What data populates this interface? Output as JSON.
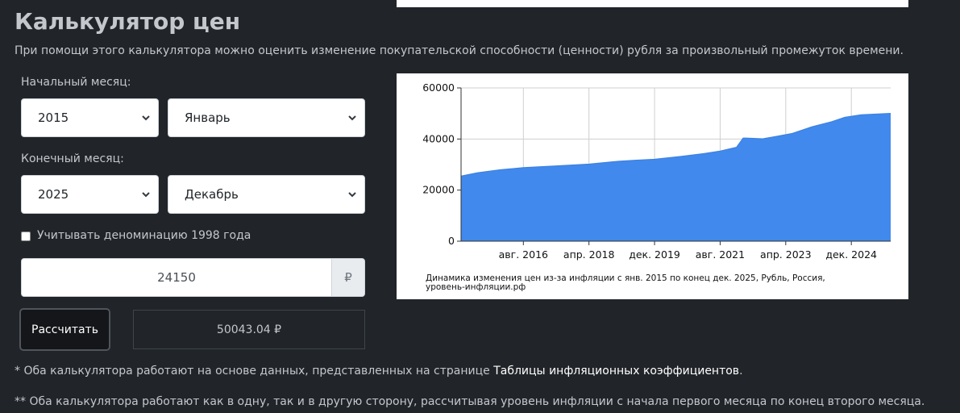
{
  "title": "Калькулятор цен",
  "description": "При помощи этого калькулятора можно оценить изменение покупательской способности (ценности) рубля за произвольный промежуток времени.",
  "form": {
    "start_label": "Начальный месяц:",
    "start_year": "2015",
    "start_month": "Январь",
    "end_label": "Конечный месяц:",
    "end_year": "2025",
    "end_month": "Декабрь",
    "denomination_label": "Учитывать деноминацию 1998 года",
    "denomination_checked": false,
    "amount": "24150",
    "currency": "₽",
    "calculate_label": "Рассчитать",
    "result": "50043.04 ₽"
  },
  "notes": {
    "note1_prefix": "* Оба калькулятора работают на основе данных, представленных на странице ",
    "note1_link": "Таблицы инфляционных коэффициентов",
    "note1_suffix": ".",
    "note2": "** Оба калькулятора работают как в одну, так и в другую сторону, рассчитывая уровень инфляции с начала первого месяца по конец второго месяца."
  },
  "chart_data": {
    "type": "area",
    "caption_line1": "Динамика изменения цен из-за инфляции с янв. 2015 по конец дек. 2025, Рубль, Россия,",
    "caption_line2": "уровень-инфляции.рф",
    "x_ticks": [
      "авг. 2016",
      "апр. 2018",
      "дек. 2019",
      "авг. 2021",
      "апр. 2023",
      "дек. 2024"
    ],
    "y_ticks": [
      "0",
      "20000",
      "40000",
      "60000"
    ],
    "ylim": [
      0,
      60000
    ],
    "xlim": [
      "2015-01",
      "2025-12"
    ],
    "grid": true,
    "color": "#4189ec",
    "x": [
      "2015-01",
      "2015-06",
      "2016-01",
      "2016-08",
      "2017-06",
      "2018-04",
      "2019-01",
      "2019-06",
      "2019-12",
      "2020-08",
      "2021-03",
      "2021-08",
      "2022-01",
      "2022-03",
      "2022-04",
      "2022-09",
      "2023-01",
      "2023-06",
      "2023-12",
      "2024-06",
      "2024-10",
      "2025-03",
      "2025-12"
    ],
    "values": [
      25500,
      26800,
      28000,
      28800,
      29500,
      30200,
      31300,
      31700,
      32100,
      33200,
      34300,
      35300,
      36800,
      40400,
      40400,
      40100,
      41000,
      42200,
      44800,
      46800,
      48500,
      49500,
      50043
    ]
  }
}
